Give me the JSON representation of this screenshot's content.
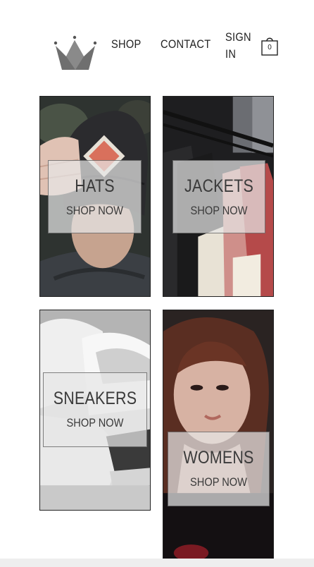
{
  "header": {
    "nav": {
      "shop": "SHOP",
      "contact": "CONTACT",
      "sign_in_line1": "SIGN",
      "sign_in_line2": "IN"
    },
    "cart": {
      "count": "0",
      "icon": "shopping-bag-icon"
    },
    "logo": {
      "icon": "crown-icon",
      "color": "#6f6f6f"
    }
  },
  "categories": [
    {
      "title": "HATS",
      "action": "SHOP NOW"
    },
    {
      "title": "JACKETS",
      "action": "SHOP NOW"
    },
    {
      "title": "SNEAKERS",
      "action": "SHOP NOW"
    },
    {
      "title": "WOMENS",
      "action": "SHOP NOW"
    }
  ]
}
